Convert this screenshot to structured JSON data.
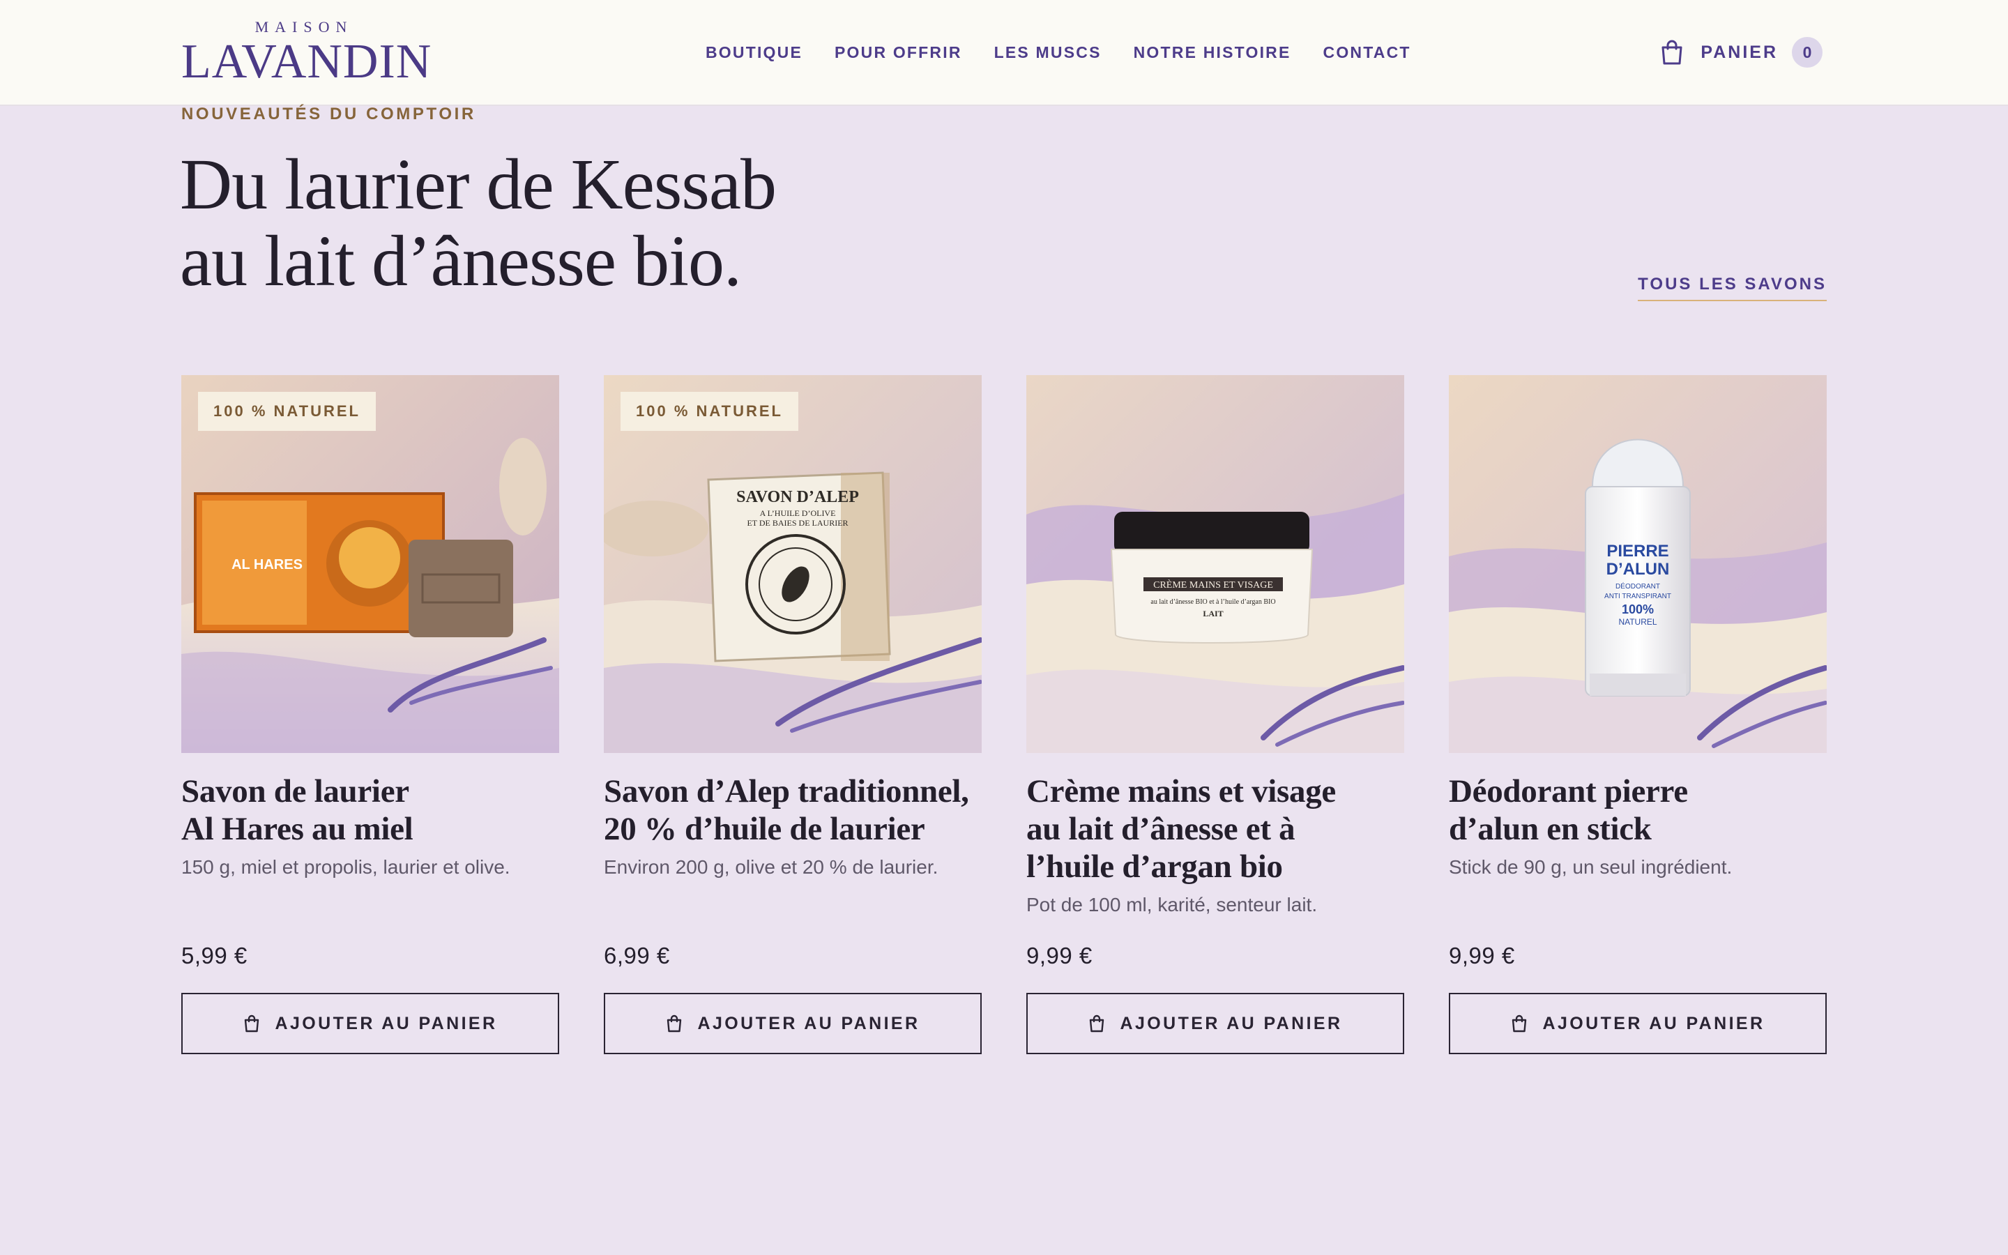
{
  "header": {
    "logo_top": "MAISON",
    "logo_main": "LAVANDIN",
    "nav": [
      "BOUTIQUE",
      "POUR OFFRIR",
      "LES MUSCS",
      "NOTRE HISTOIRE",
      "CONTACT"
    ],
    "cart_label": "PANIER",
    "cart_count": "0"
  },
  "section": {
    "eyebrow": "NOUVEAUTÉS DU COMPTOIR",
    "headline_line1": "Du laurier de Kessab",
    "headline_line2": "au lait d’ânesse bio.",
    "all_link": "TOUS LES SAVONS"
  },
  "products": [
    {
      "badge": "100 % NATUREL",
      "title": "Savon de laurier\nAl Hares au miel",
      "desc": "150 g, miel et propolis, laurier et olive.",
      "price": "5,99 €",
      "button": "AJOUTER AU PANIER",
      "image": "al-hares-soap-box-image",
      "image_text": [
        "AL HARES"
      ]
    },
    {
      "badge": "100 % NATUREL",
      "title": "Savon d’Alep traditionnel,\n20 % d’huile de laurier",
      "desc": "Environ 200 g, olive et 20 % de laurier.",
      "price": "6,99 €",
      "button": "AJOUTER AU PANIER",
      "image": "aleppo-soap-image",
      "image_text": [
        "SAVON D’ALEP",
        "A L’HUILE D’OLIVE",
        "ET DE BAIES DE LAURIER"
      ]
    },
    {
      "badge": "",
      "title": "Crème mains et visage\nau lait d’ânesse et à\nl’huile d’argan bio",
      "desc": "Pot de 100 ml, karité, senteur lait.",
      "price": "9,99 €",
      "button": "AJOUTER AU PANIER",
      "image": "cream-jar-image",
      "image_text": [
        "CRÈME MAINS ET VISAGE",
        "au lait d’ânesse BIO et à l’huile d’argan BIO",
        "LAIT"
      ]
    },
    {
      "badge": "",
      "title": "Déodorant pierre\nd’alun en stick",
      "desc": "Stick de 90 g, un seul ingrédient.",
      "price": "9,99 €",
      "button": "AJOUTER AU PANIER",
      "image": "alum-stick-image",
      "image_text": [
        "PIERRE",
        "D’ALUN",
        "DÉODORANT",
        "ANTI TRANSPIRANT",
        "100%",
        "NATUREL"
      ]
    }
  ],
  "colors": {
    "background": "#ebe3f0",
    "header": "#fbfaf5",
    "brand_purple": "#4d3c8a",
    "accent_gold": "#86643a",
    "text_dark": "#241f2c"
  }
}
